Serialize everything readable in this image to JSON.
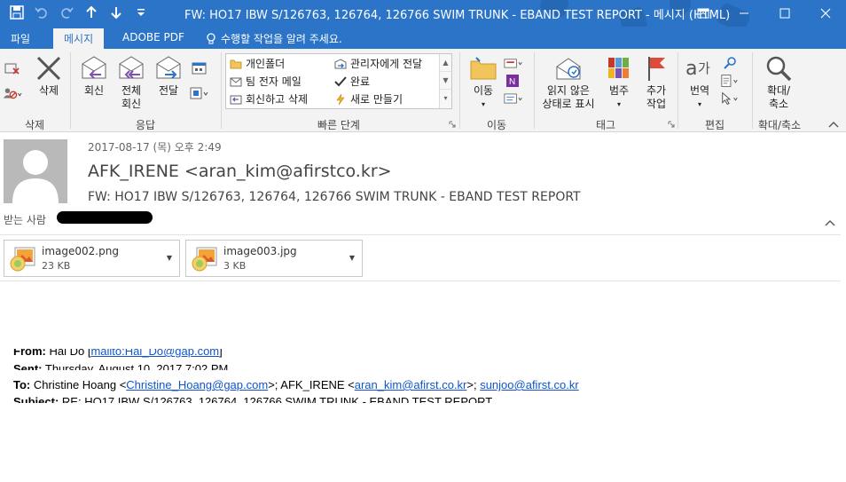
{
  "window": {
    "title": "FW: HO17 IBW S/126763, 126764, 126766 SWIM TRUNK - EBAND TEST REPORT - 메시지 (HTML)"
  },
  "tabs": [
    {
      "label": "파일"
    },
    {
      "label": "메시지"
    },
    {
      "label": "ADOBE PDF"
    }
  ],
  "tell_me": "수행할 작업을 알려 주세요.",
  "ribbon": {
    "delete_group": {
      "label": "삭제",
      "delete_button": "삭제"
    },
    "respond_group": {
      "label": "응답",
      "reply": "회신",
      "reply_all_line1": "전체",
      "reply_all_line2": "회신",
      "forward": "전달"
    },
    "quick_steps": {
      "label": "빠른 단계",
      "items": [
        "개인폴더",
        "팀 전자 메일",
        "회신하고 삭제",
        "관리자에게 전달",
        "완료",
        "새로 만들기"
      ]
    },
    "move_group": {
      "label": "이동",
      "move_button": "이동"
    },
    "tags_group": {
      "label": "태그",
      "unread_line1": "읽지 않은",
      "unread_line2": "상태로 표시",
      "categorize": "범주",
      "followup_line1": "추가",
      "followup_line2": "작업"
    },
    "edit_group": {
      "label": "편집",
      "translate": "번역"
    },
    "zoom_group": {
      "label": "확대/축소",
      "zoom_line1": "확대/",
      "zoom_line2": "축소"
    }
  },
  "message": {
    "date": "2017-08-17 (목) 오후 2:49",
    "sender": "AFK_IRENE <aran_kim@afirstco.kr>",
    "subject": "FW: HO17 IBW S/126763, 126764, 126766 SWIM TRUNK - EBAND TEST REPORT",
    "to_label": "받는 사람"
  },
  "attachments": [
    {
      "name": "image002.png",
      "size": "23 KB"
    },
    {
      "name": "image003.jpg",
      "size": "3 KB"
    }
  ],
  "body": {
    "from_label": "From:",
    "from_name": "Hai Do [",
    "from_link": "mailto:Hai_Do@gap.com",
    "from_end": "]",
    "sent_label": "Sent:",
    "sent_value": "Thursday, August 10, 2017 7:02 PM",
    "to_label": "To:",
    "to_value": "Christine Hoang <",
    "to_link1": "Christine_Hoang@gap.com",
    "to_mid": ">; AFK_IRENE <",
    "to_link2": "aran_kim@afirst.co.kr",
    "to_end": ">; ",
    "to_link3": "sunjoo@afirst.co.kr",
    "subject_label": "Subject:",
    "subject_value": "RE: HO17 IBW S/126763, 126764, 126766 SWIM TRUNK - EBAND TEST REPORT"
  },
  "colors": {
    "accent": "#2b74c7",
    "link": "#1155cc"
  }
}
